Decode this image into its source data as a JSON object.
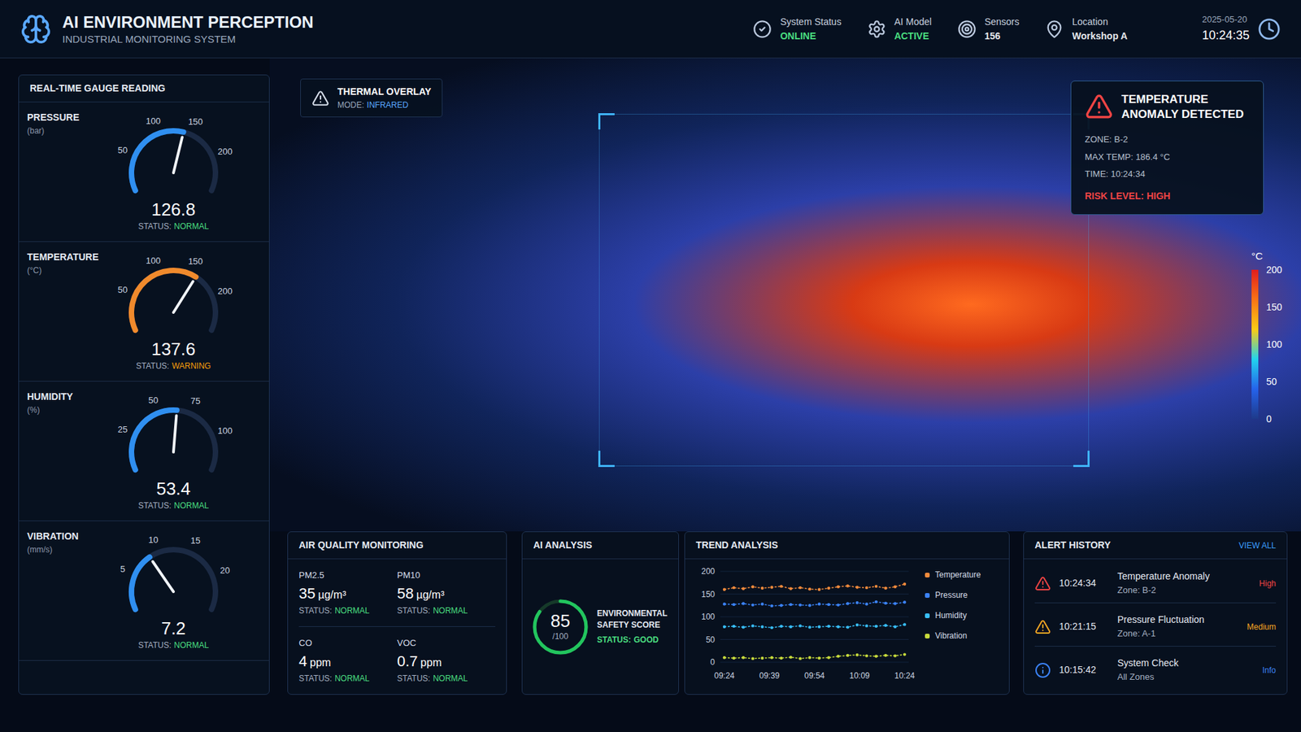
{
  "header": {
    "title": "AI ENVIRONMENT PERCEPTION",
    "subtitle": "INDUSTRIAL MONITORING SYSTEM",
    "status_items": [
      {
        "label": "System Status",
        "value": "ONLINE",
        "kind": "status",
        "color": "#4ade80"
      },
      {
        "label": "AI Model",
        "value": "ACTIVE",
        "kind": "model",
        "color": "#4ade80"
      },
      {
        "label": "Sensors",
        "value": "156",
        "kind": "sensors",
        "color": "#e5e7eb"
      },
      {
        "label": "Location",
        "value": "Workshop A",
        "kind": "location",
        "color": "#e5e7eb"
      }
    ],
    "date": "2025-05-20",
    "time": "10:24:35"
  },
  "gauge_panel": {
    "title": "REAL-TIME GAUGE READING",
    "gauges": [
      {
        "label": "PRESSURE",
        "unit": "(bar)",
        "ticks": [
          "50",
          "100",
          "150",
          "200"
        ],
        "value": "126.8",
        "status_label": "STATUS:",
        "status": "NORMAL",
        "status_color": "#4ade80",
        "color": "#2f8ff0",
        "level": 0.56
      },
      {
        "label": "TEMPERATURE",
        "unit": "(°C)",
        "ticks": [
          "50",
          "100",
          "150",
          "200"
        ],
        "value": "137.6",
        "status_label": "STATUS:",
        "status": "WARNING",
        "status_color": "#f59e0b",
        "color": "#f08a2c",
        "level": 0.64
      },
      {
        "label": "HUMIDITY",
        "unit": "(%)",
        "ticks": [
          "25",
          "50",
          "75",
          "100"
        ],
        "value": "53.4",
        "status_label": "STATUS:",
        "status": "NORMAL",
        "status_color": "#4ade80",
        "color": "#2f8ff0",
        "level": 0.52
      },
      {
        "label": "VIBRATION",
        "unit": "(mm/s)",
        "ticks": [
          "5",
          "10",
          "15",
          "20"
        ],
        "value": "7.2",
        "status_label": "STATUS:",
        "status": "NORMAL",
        "status_color": "#4ade80",
        "color": "#2f8ff0",
        "level": 0.35
      }
    ]
  },
  "view": {
    "overlay_title": "THERMAL OVERLAY",
    "overlay_mode_label": "MODE:",
    "overlay_mode": "INFRARED",
    "alert": {
      "title": "TEMPERATURE ANOMALY DETECTED",
      "lines": [
        "ZONE: B-2",
        "MAX TEMP: 186.4 °C",
        "TIME: 10:24:34"
      ],
      "risk_label": "RISK LEVEL:",
      "risk": "HIGH"
    },
    "scale": {
      "unit": "°C",
      "ticks": [
        "200",
        "150",
        "100",
        "50",
        "0"
      ]
    }
  },
  "air_quality": {
    "title": "AIR QUALITY MONITORING",
    "items": [
      {
        "label": "PM2.5",
        "value": "35",
        "unit": "µg/m³",
        "status_label": "STATUS:",
        "status": "NORMAL"
      },
      {
        "label": "PM10",
        "value": "58",
        "unit": "µg/m³",
        "status_label": "STATUS:",
        "status": "NORMAL"
      },
      {
        "label": "CO",
        "value": "4",
        "unit": "ppm",
        "status_label": "STATUS:",
        "status": "NORMAL"
      },
      {
        "label": "VOC",
        "value": "0.7",
        "unit": "ppm",
        "status_label": "STATUS:",
        "status": "NORMAL"
      }
    ]
  },
  "ai_analysis": {
    "title": "AI ANALYSIS",
    "score": "85",
    "max": "/100",
    "level": 0.85,
    "label": "ENVIRONMENTAL SAFETY SCORE",
    "status_label": "STATUS:",
    "status": "GOOD"
  },
  "trend": {
    "title": "TREND ANALYSIS",
    "y_ticks": [
      "200",
      "150",
      "100",
      "50",
      "0"
    ],
    "x_ticks": [
      "09:24",
      "09:39",
      "09:54",
      "10:09",
      "10:24"
    ],
    "series": [
      {
        "name": "Temperature",
        "color": "#f08a3c",
        "values": [
          160,
          164,
          162,
          166,
          163,
          165,
          167,
          162,
          164,
          161,
          160,
          163,
          166,
          168,
          165,
          164,
          167,
          163,
          166,
          172
        ]
      },
      {
        "name": "Pressure",
        "color": "#3b82f6",
        "values": [
          128,
          127,
          129,
          126,
          128,
          124,
          125,
          127,
          126,
          125,
          128,
          127,
          126,
          129,
          131,
          128,
          133,
          130,
          129,
          132
        ]
      },
      {
        "name": "Humidity",
        "color": "#38bdf8",
        "values": [
          78,
          79,
          77,
          80,
          78,
          76,
          79,
          78,
          80,
          77,
          78,
          79,
          78,
          77,
          82,
          80,
          79,
          81,
          78,
          83
        ]
      },
      {
        "name": "Vibration",
        "color": "#c6d93c",
        "values": [
          10,
          9,
          10,
          8,
          9,
          10,
          9,
          11,
          8,
          10,
          9,
          10,
          13,
          15,
          16,
          14,
          13,
          15,
          14,
          17
        ]
      }
    ]
  },
  "alert_history": {
    "title": "ALERT HISTORY",
    "view_all": "VIEW ALL",
    "items": [
      {
        "time": "10:24:34",
        "title": "Temperature Anomaly",
        "zone": "Zone: B-2",
        "severity": "High",
        "kind": "warning",
        "color": "#ef4444"
      },
      {
        "time": "10:21:15",
        "title": "Pressure Fluctuation",
        "zone": "Zone: A-1",
        "severity": "Medium",
        "kind": "warning",
        "color": "#f5a623"
      },
      {
        "time": "10:15:42",
        "title": "System Check",
        "zone": "All Zones",
        "severity": "Info",
        "kind": "info",
        "color": "#3b82f6"
      }
    ]
  }
}
